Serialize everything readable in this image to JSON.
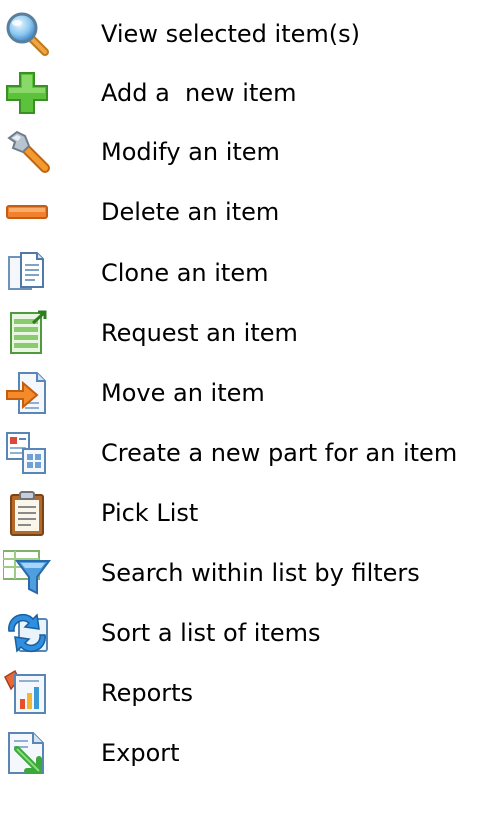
{
  "legend": {
    "items": [
      {
        "icon": "magnifier-icon",
        "label": "View selected item(s)"
      },
      {
        "icon": "green-plus-icon",
        "label": "Add a  new item"
      },
      {
        "icon": "wrench-icon",
        "label": "Modify an item"
      },
      {
        "icon": "orange-minus-icon",
        "label": "Delete an item"
      },
      {
        "icon": "clone-documents-icon",
        "label": "Clone an item"
      },
      {
        "icon": "request-form-icon",
        "label": "Request an item"
      },
      {
        "icon": "move-document-icon",
        "label": "Move an item"
      },
      {
        "icon": "new-part-icon",
        "label": "Create a new part for an item"
      },
      {
        "icon": "clipboard-icon",
        "label": "Pick List"
      },
      {
        "icon": "filter-funnel-icon",
        "label": "Search within list by filters"
      },
      {
        "icon": "sort-refresh-icon",
        "label": "Sort a list of items"
      },
      {
        "icon": "reports-chart-icon",
        "label": "Reports"
      },
      {
        "icon": "export-arrow-icon",
        "label": "Export"
      }
    ]
  }
}
